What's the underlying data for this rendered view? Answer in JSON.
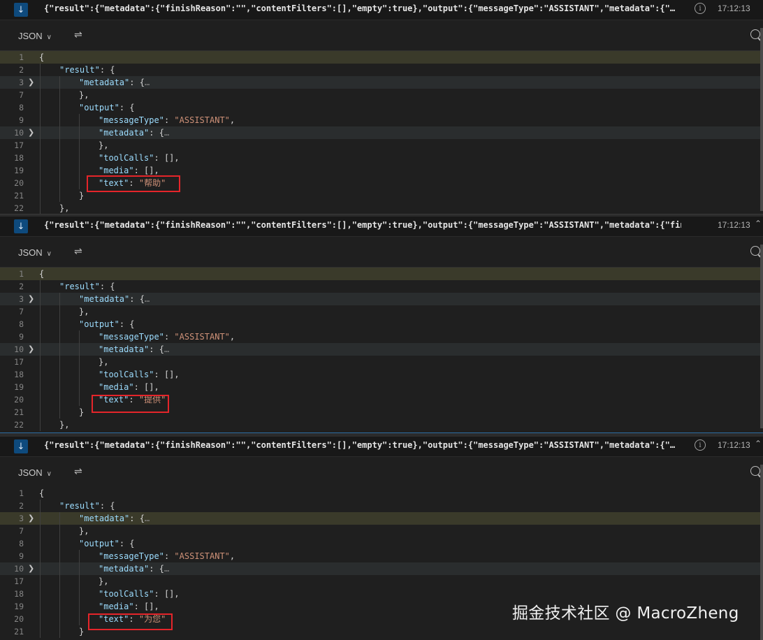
{
  "message_preview": [
    "{\"result\":{\"metadata\":{\"finishReason\":\"\",\"contentFilters\":[],\"empty\":true},\"output\":{\"messageType\":\"ASSISTANT\",\"metadata\":{\"…",
    "{\"result\":{\"metadata\":{\"finishReason\":\"\",\"contentFilters\":[],\"empty\":true},\"output\":{\"messageType\":\"ASSISTANT\",\"metadata\":{\"finis…",
    "{\"result\":{\"metadata\":{\"finishReason\":\"\",\"contentFilters\":[],\"empty\":true},\"output\":{\"messageType\":\"ASSISTANT\",\"metadata\":{\"…"
  ],
  "timestamp": "17:12:13",
  "format_label": "JSON",
  "icons": {
    "down": "arrow-down-icon",
    "info": "info-icon",
    "wrap": "word-wrap-icon",
    "search": "search-icon",
    "collapse": "chevron-up-icon",
    "fold": "chevron-right-icon"
  },
  "line_numbers": [
    "1",
    "2",
    "3",
    "7",
    "8",
    "9",
    "10",
    "17",
    "18",
    "19",
    "20",
    "21",
    "22"
  ],
  "panels": [
    {
      "text_value": "帮助"
    },
    {
      "text_value": "提供"
    },
    {
      "text_value": "为您"
    }
  ],
  "keys": {
    "result": "result",
    "metadata": "metadata",
    "output": "output",
    "messageType": "messageType",
    "toolCalls": "toolCalls",
    "media": "media",
    "text": "text"
  },
  "values": {
    "messageType": "ASSISTANT"
  },
  "watermark": "掘金技术社区 @ MacroZheng",
  "colors": {
    "highlight_box": "#e5252a",
    "key": "#9cdcfe",
    "string": "#ce9178",
    "background": "#1f1f1f"
  }
}
